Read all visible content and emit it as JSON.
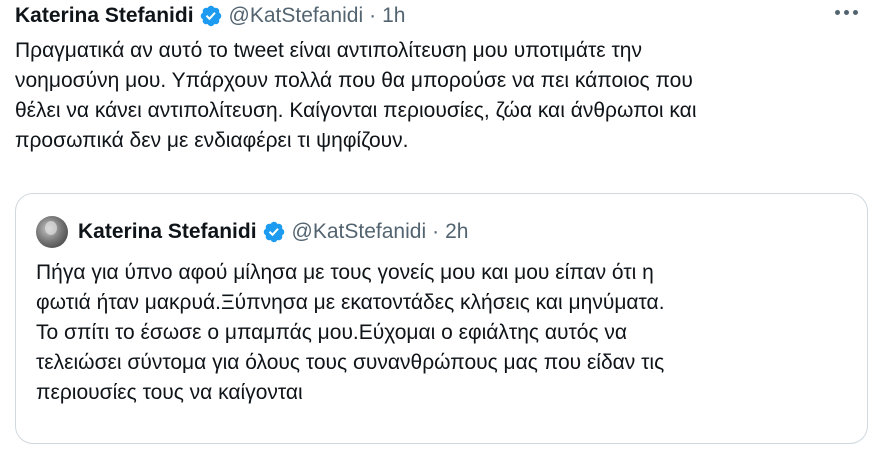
{
  "tweet": {
    "author_name": "Katerina Stefanidi",
    "handle": "@KatStefanidi",
    "separator": "·",
    "time": "1h",
    "text": "Πραγματικά αν αυτό το tweet είναι αντιπολίτευση μου υποτιμάτε την\nνοημοσύνη μου. Υπάρχουν πολλά που θα μπορούσε να πει κάποιος που\nθέλει να κάνει αντιπολίτευση. Καίγονται περιουσίες, ζώα και άνθρωποι και\nπροσωπικά δεν με ενδιαφέρει τι ψηφίζουν."
  },
  "quoted_tweet": {
    "author_name": "Katerina Stefanidi",
    "handle": "@KatStefanidi",
    "separator": "·",
    "time": "2h",
    "text": "Πήγα για ύπνο αφού μίλησα με τους γονείς μου και μου είπαν ότι η\nφωτιά ήταν μακρυά.Ξύπνησα με εκατοντάδες κλήσεις και μηνύματα.\nΤο σπίτι το έσωσε ο μπαμπάς μου.Εύχομαι ο εφιάλτης αυτός να\nτελειώσει σύντομα για όλους τους συνανθρώπους μας που είδαν τις\nπεριουσίες τους να καίγονται"
  },
  "icons": {
    "verified": "verified-badge-icon",
    "more": "more-horizontal-icon"
  },
  "colors": {
    "text": "#0f1419",
    "secondary": "#536471",
    "verified_blue": "#1d9bf0",
    "border": "#cfd9de"
  }
}
